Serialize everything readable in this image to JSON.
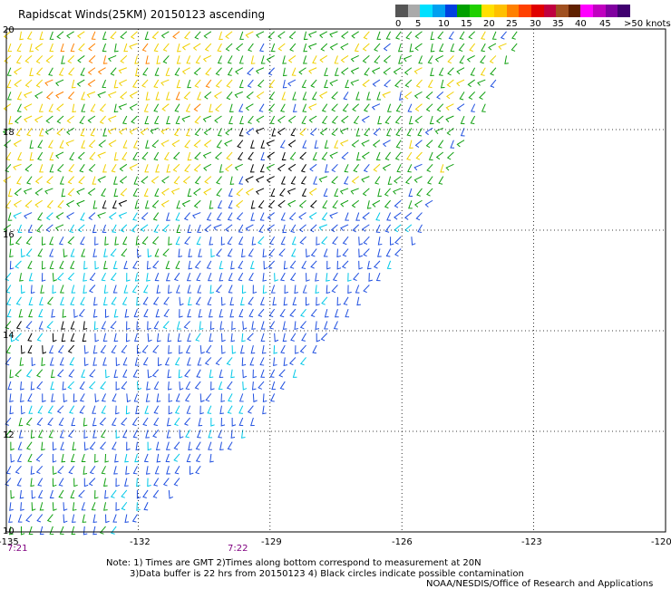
{
  "title": "Rapidscat Winds(25KM) 20150123 ascending",
  "colorbar": {
    "colors": [
      "#555555",
      "#aaaaaa",
      "#00e0ff",
      "#00a0f0",
      "#0040e0",
      "#00a000",
      "#20d000",
      "#ffe000",
      "#ffc000",
      "#ff8000",
      "#ff4000",
      "#e00000",
      "#c00040",
      "#a05020",
      "#602000",
      "#ff00ff",
      "#c000c0",
      "#8000a0",
      "#400070"
    ],
    "ticks": [
      "0",
      "5",
      "10",
      "15",
      "20",
      "25",
      "30",
      "35",
      "40",
      "45",
      ">50 knots"
    ]
  },
  "lat_labels": [
    "20",
    "18",
    "16",
    "14",
    "12",
    "10"
  ],
  "lon_labels": [
    "-135",
    "-132",
    "-129",
    "-126",
    "-123",
    "-120"
  ],
  "time_labels": [
    "7:21",
    "7:22"
  ],
  "notes": [
    "Note: 1) Times are GMT 2)Times along bottom correspond to measurement at 20N",
    "3)Data buffer is 22 hrs from 20150123 4) Black circles indicate possible contamination",
    "NOAA/NESDIS/Office of Research and Applications"
  ],
  "map_data": {
    "lon_range": [
      -135,
      -120
    ],
    "lat_range": [
      10,
      20
    ],
    "swath_east_edge": [
      [
        -123.2,
        20
      ],
      [
        -125.6,
        16
      ],
      [
        -129.5,
        12
      ],
      [
        -132.5,
        10
      ]
    ],
    "wind_colors": {
      "slow": "#00c8e8",
      "mid": "#2050e0",
      "moderate": "#10a010",
      "fast": "#f0d000",
      "strong": "#ff8000",
      "contam": "#000000"
    }
  }
}
